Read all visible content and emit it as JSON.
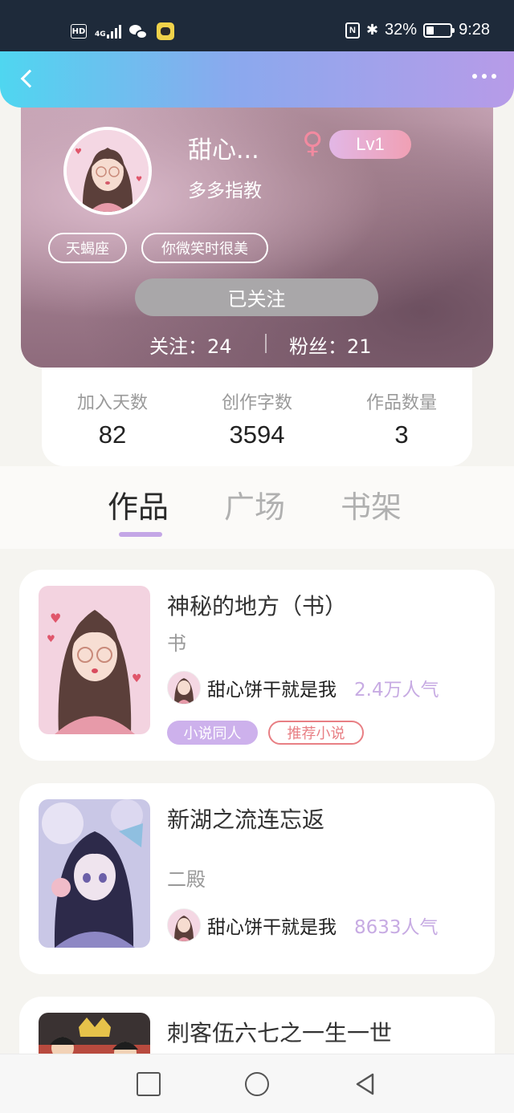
{
  "status_bar": {
    "hd": "HD",
    "network": "4G",
    "battery_percent": "32%",
    "time": "9:28"
  },
  "header": {
    "back_icon": "chevron-left-icon",
    "more_icon": "more-horizontal-icon"
  },
  "profile": {
    "nickname": "甜心...",
    "gender_icon": "female-icon",
    "level": "Lv1",
    "signature": "多多指教",
    "tags": [
      "天蝎座",
      "你微笑时很美"
    ],
    "follow_button": "已关注",
    "following": "关注：24",
    "followers": "粉丝：21"
  },
  "stats": [
    {
      "label": "加入天数",
      "value": "82"
    },
    {
      "label": "创作字数",
      "value": "3594"
    },
    {
      "label": "作品数量",
      "value": "3"
    }
  ],
  "tabs": [
    {
      "label": "作品",
      "active": true
    },
    {
      "label": "广场",
      "active": false
    },
    {
      "label": "书架",
      "active": false
    }
  ],
  "books": [
    {
      "title": "神秘的地方（书）",
      "subtitle": "书",
      "author": "甜心饼干就是我",
      "popularity": "2.4万人气",
      "tags": [
        "小说同人",
        "推荐小说"
      ]
    },
    {
      "title": "新湖之流连忘返",
      "subtitle": "二殿",
      "author": "甜心饼干就是我",
      "popularity": "8633人气",
      "tags": []
    },
    {
      "title": "刺客伍六七之一生一世",
      "subtitle": "",
      "author": "",
      "popularity": "",
      "tags": []
    }
  ],
  "nav": {
    "recent_icon": "square-icon",
    "home_icon": "circle-icon",
    "back_icon": "triangle-back-icon"
  },
  "colors": {
    "header_start": "#4fd6f0",
    "header_end": "#b79be8",
    "accent_purple": "#c4a6e6",
    "popularity": "#c7abe3",
    "tag_red": "#e87f84"
  }
}
